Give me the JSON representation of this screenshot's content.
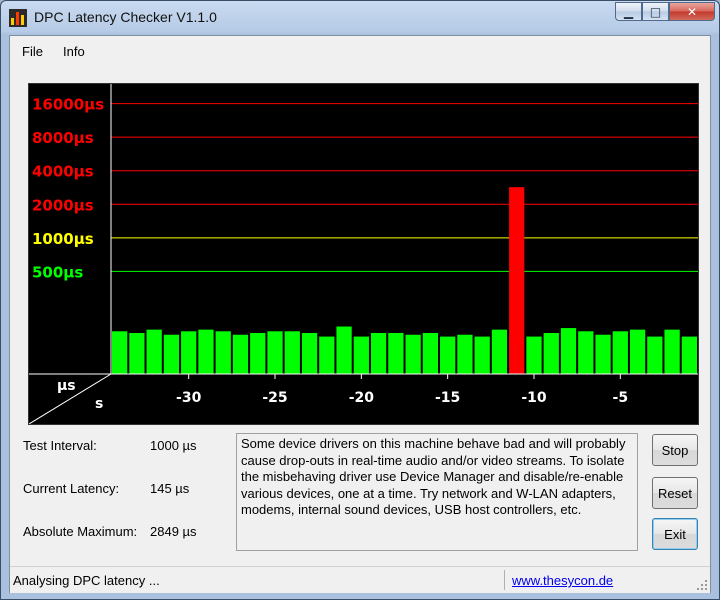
{
  "window": {
    "title": "DPC Latency Checker V1.1.0"
  },
  "menu": {
    "items": [
      "File",
      "Info"
    ]
  },
  "chart_data": {
    "type": "bar",
    "ylabel": "µs",
    "xlabel": "s",
    "y_scale": "log",
    "y_ticks": [
      {
        "label": "16000µs",
        "value": 16000,
        "color": "#ff0000"
      },
      {
        "label": "8000µs",
        "value": 8000,
        "color": "#ff0000"
      },
      {
        "label": "4000µs",
        "value": 4000,
        "color": "#ff0000"
      },
      {
        "label": "2000µs",
        "value": 2000,
        "color": "#ff0000"
      },
      {
        "label": "1000µs",
        "value": 1000,
        "color": "#ffff00"
      },
      {
        "label": "500µs",
        "value": 500,
        "color": "#00ff00"
      }
    ],
    "x_ticks": [
      {
        "label": "-30",
        "value": -30
      },
      {
        "label": "-25",
        "value": -25
      },
      {
        "label": "-20",
        "value": -20
      },
      {
        "label": "-15",
        "value": -15
      },
      {
        "label": "-10",
        "value": -10
      },
      {
        "label": "-5",
        "value": -5
      }
    ],
    "x_range": [
      -34.5,
      -0.5
    ],
    "ylim": [
      60,
      24000
    ],
    "values": [
      145,
      140,
      150,
      135,
      145,
      150,
      145,
      135,
      140,
      145,
      145,
      140,
      130,
      160,
      130,
      140,
      140,
      135,
      140,
      130,
      135,
      130,
      150,
      2849,
      130,
      140,
      155,
      145,
      135,
      145,
      150,
      130,
      150,
      130,
      210
    ],
    "bar_colors": {
      "normal": "#00ff00",
      "warning": "#ffff00",
      "alert": "#ff0000"
    },
    "grid": true
  },
  "stats": {
    "test_interval": {
      "label": "Test Interval:",
      "value": "1000 µs"
    },
    "current_latency": {
      "label": "Current Latency:",
      "value": "145 µs"
    },
    "absolute_maximum": {
      "label": "Absolute Maximum:",
      "value": "2849 µs"
    }
  },
  "message": "Some device drivers on this machine behave bad and will probably cause drop-outs in real-time audio and/or video streams. To isolate the misbehaving driver use Device Manager and disable/re-enable various devices, one at a time. Try network and W-LAN adapters, modems, internal sound devices, USB host controllers, etc.",
  "buttons": {
    "stop": "Stop",
    "reset": "Reset",
    "exit": "Exit"
  },
  "status": {
    "text": "Analysing DPC latency ...",
    "link": "www.thesycon.de"
  }
}
